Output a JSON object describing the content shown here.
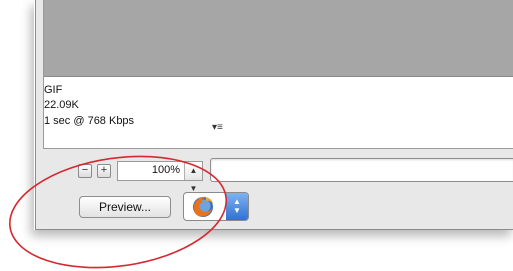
{
  "image_info": {
    "format": "GIF",
    "file_size": "22.09K",
    "download_time": "1 sec @ 768 Kbps",
    "menu_icon": "menu-lines-icon"
  },
  "zoom": {
    "value": "100%",
    "minus_icon": "minus-icon",
    "plus_icon": "plus-icon",
    "stepper_icon": "stepper-arrows-icon"
  },
  "status_field": {
    "value": ""
  },
  "buttons": {
    "preview_label": "Preview..."
  },
  "browser_selector": {
    "icon": "firefox-icon",
    "arrows_icon": "up-down-arrows-icon"
  },
  "colors": {
    "annotation_circle": "#d6282f",
    "image_area": "#a6a6a6",
    "popup_accent": "#2e72d2"
  }
}
